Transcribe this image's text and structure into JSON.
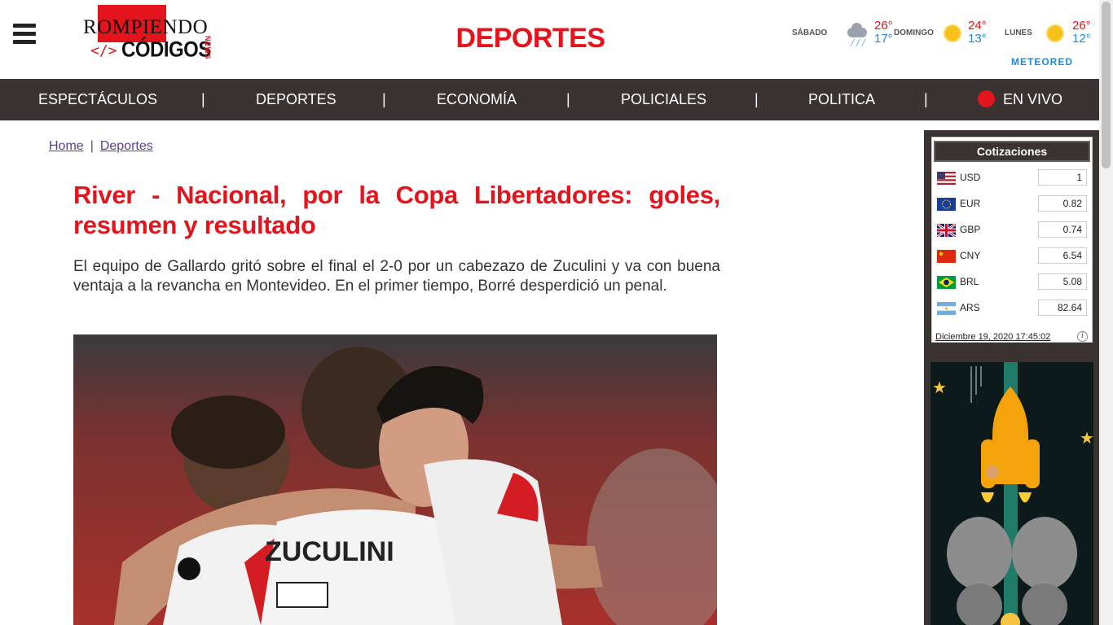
{
  "header": {
    "logo_top": "ROMPIENDO",
    "logo_code": "</>",
    "logo_bottom": "CÓDIGOS",
    "logo_news": "NEWS",
    "section_title": "DEPORTES"
  },
  "weather": {
    "days": [
      {
        "name": "SÁBADO",
        "icon": "rain-cloud-icon",
        "high": "26°",
        "low": "17°"
      },
      {
        "name": "DOMINGO",
        "icon": "sun-icon",
        "high": "24°",
        "low": "13°"
      },
      {
        "name": "LUNES",
        "icon": "sun-icon",
        "high": "26°",
        "low": "12°"
      }
    ],
    "provider": "METEORED"
  },
  "nav": {
    "items": [
      "ESPECTÁCULOS",
      "DEPORTES",
      "ECONOMÍA",
      "POLICIALES",
      "POLITICA",
      "EN VIVO"
    ],
    "separator": "|"
  },
  "breadcrumb": {
    "home": "Home",
    "separator": "|",
    "current": "Deportes"
  },
  "article": {
    "headline": "River - Nacional, por la Copa Libertadores: goles, resumen y resultado",
    "summary": "El equipo de Gallardo gritó sobre el final el 2-0 por un cabezazo de Zuculini y va con buena ventaja a la revancha en Montevideo. En el primer tiempo, Borré desperdició un penal.",
    "image_text": "ZUCULINI"
  },
  "quotes": {
    "title": "Cotizaciones",
    "rows": [
      {
        "code": "USD",
        "value": "1"
      },
      {
        "code": "EUR",
        "value": "0.82"
      },
      {
        "code": "GBP",
        "value": "0.74"
      },
      {
        "code": "CNY",
        "value": "6.54"
      },
      {
        "code": "BRL",
        "value": "5.08"
      },
      {
        "code": "ARS",
        "value": "82.64"
      }
    ],
    "date": "Diciembre 19, 2020 17:45:02",
    "info": "i"
  },
  "colors": {
    "brand_red": "#e3141b",
    "nav_bg": "#3a3331",
    "link_purple": "#5e3d91"
  }
}
